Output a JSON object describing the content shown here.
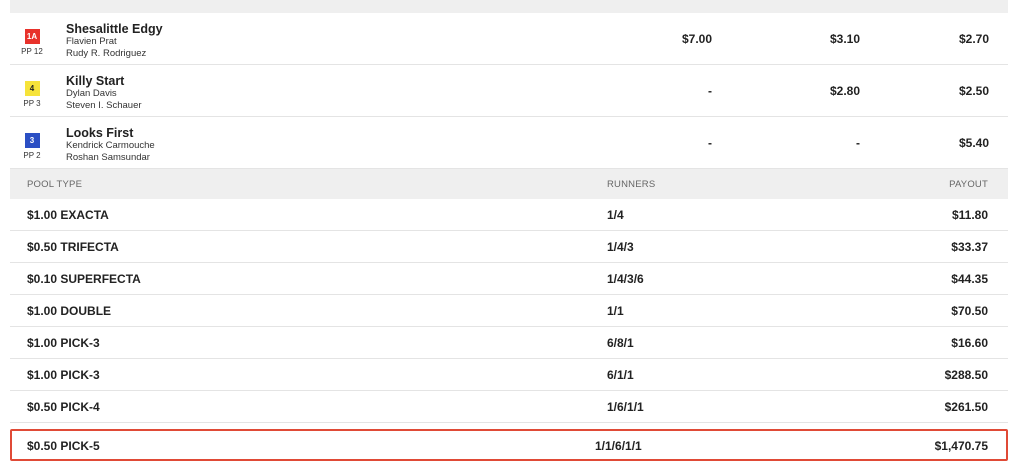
{
  "runners": [
    {
      "saddle": "1A",
      "saddle_bg": "#e8322b",
      "saddle_fg": "#ffffff",
      "pp": "PP 12",
      "name": "Shesalittle Edgy",
      "jockey": "Flavien Prat",
      "trainer": "Rudy R. Rodriguez",
      "win": "$7.00",
      "place": "$3.10",
      "show": "$2.70"
    },
    {
      "saddle": "4",
      "saddle_bg": "#f6e33a",
      "saddle_fg": "#222222",
      "pp": "PP 3",
      "name": "Killy Start",
      "jockey": "Dylan Davis",
      "trainer": "Steven I. Schauer",
      "win": "-",
      "place": "$2.80",
      "show": "$2.50"
    },
    {
      "saddle": "3",
      "saddle_bg": "#2b4fc4",
      "saddle_fg": "#ffffff",
      "pp": "PP 2",
      "name": "Looks First",
      "jockey": "Kendrick Carmouche",
      "trainer": "Roshan Samsundar",
      "win": "-",
      "place": "-",
      "show": "$5.40"
    }
  ],
  "pools": {
    "headers": {
      "type": "POOL TYPE",
      "runners": "RUNNERS",
      "payout": "PAYOUT"
    },
    "rows": [
      {
        "type": "$1.00 EXACTA",
        "runners": "1/4",
        "payout": "$11.80"
      },
      {
        "type": "$0.50 TRIFECTA",
        "runners": "1/4/3",
        "payout": "$33.37"
      },
      {
        "type": "$0.10 SUPERFECTA",
        "runners": "1/4/3/6",
        "payout": "$44.35"
      },
      {
        "type": "$1.00 DOUBLE",
        "runners": "1/1",
        "payout": "$70.50"
      },
      {
        "type": "$1.00 PICK-3",
        "runners": "6/8/1",
        "payout": "$16.60"
      },
      {
        "type": "$1.00 PICK-3",
        "runners": "6/1/1",
        "payout": "$288.50"
      },
      {
        "type": "$0.50 PICK-4",
        "runners": "1/6/1/1",
        "payout": "$261.50"
      },
      {
        "type": "$0.50 PICK-5",
        "runners": "1/1/6/1/1",
        "payout": "$1,470.75"
      }
    ],
    "highlight_color": "#e04a36"
  }
}
